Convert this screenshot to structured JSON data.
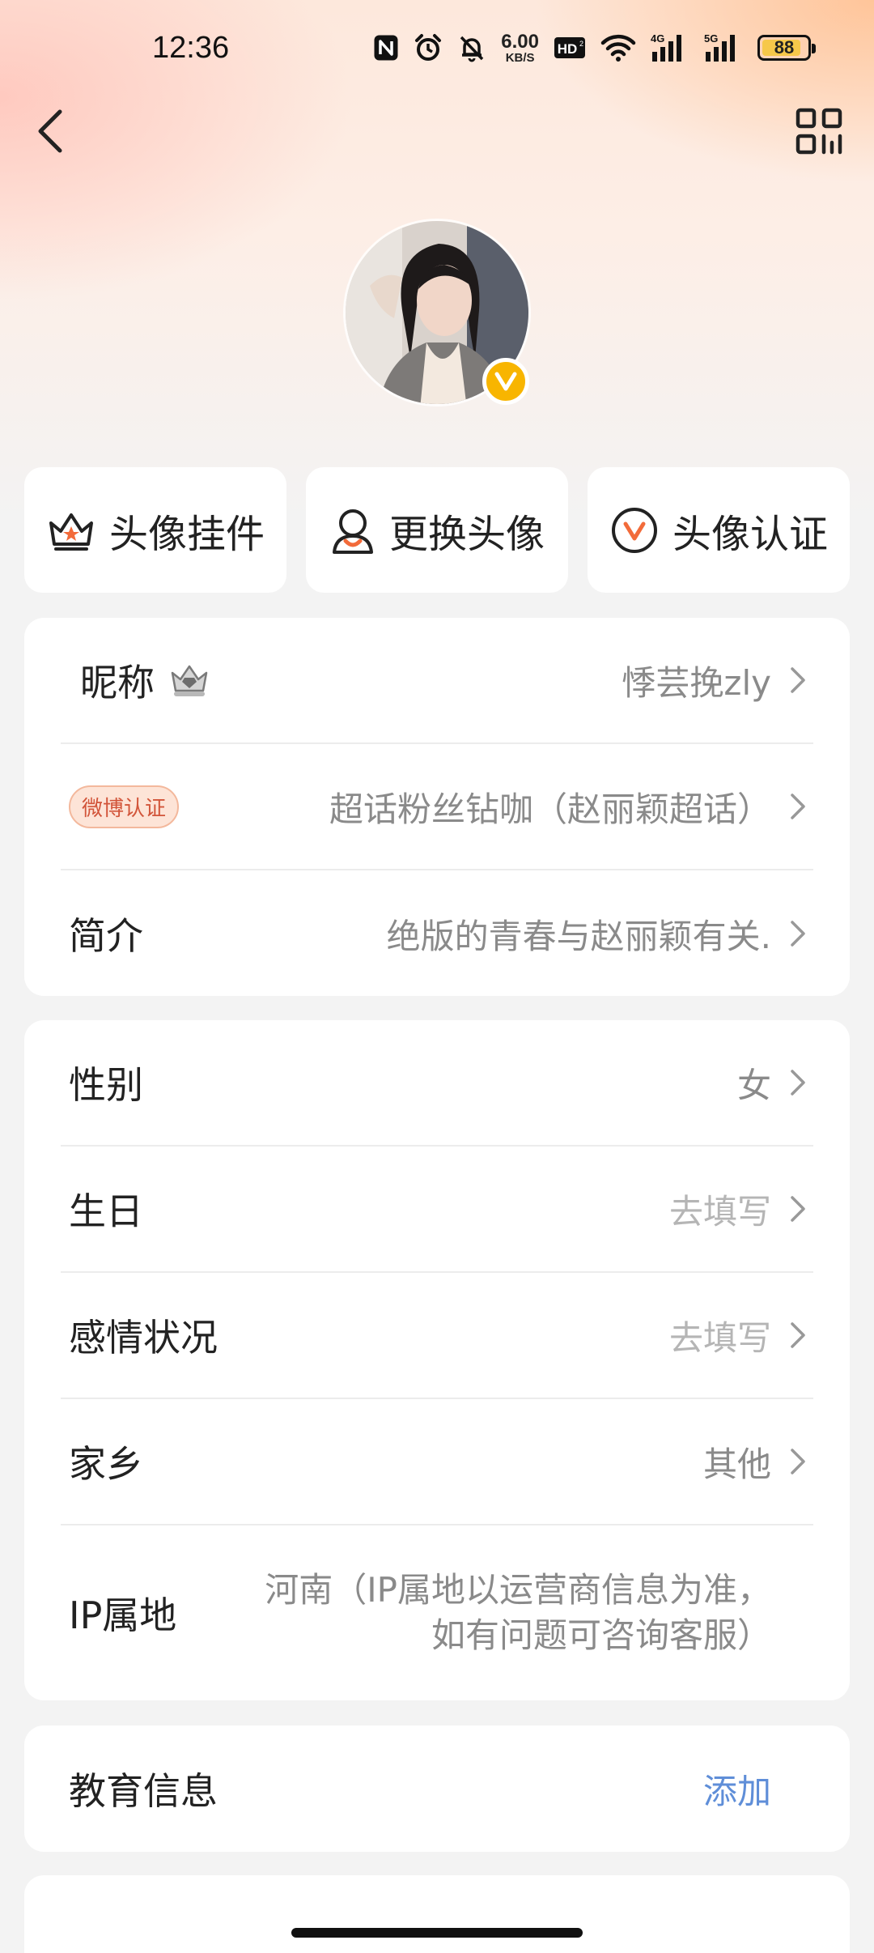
{
  "status_bar": {
    "time": "12:36",
    "net_speed_value": "6.00",
    "net_speed_unit": "KB/S",
    "hd_label": "HD",
    "network_4g": "4G",
    "network_5g": "5G",
    "battery": "88",
    "battery_level": 0.88
  },
  "avatar_actions": [
    {
      "label": "头像挂件",
      "icon": "crown-icon"
    },
    {
      "label": "更换头像",
      "icon": "person-icon"
    },
    {
      "label": "头像认证",
      "icon": "v-badge-icon"
    }
  ],
  "profile": {
    "nickname_label": "昵称",
    "nickname_value": "悸芸挽zly",
    "weibo_tag": "微博认证",
    "verification_value": "超话粉丝钻咖（赵丽颖超话）",
    "bio_label": "简介",
    "bio_value": "绝版的青春与赵丽颖有关."
  },
  "details": {
    "gender_label": "性别",
    "gender_value": "女",
    "birthday_label": "生日",
    "birthday_value": "去填写",
    "relationship_label": "感情状况",
    "relationship_value": "去填写",
    "hometown_label": "家乡",
    "hometown_value": "其他",
    "ip_label": "IP属地",
    "ip_value_line1": "河南（IP属地以运营商信息为准，",
    "ip_value_line2": "如有问题可咨询客服）"
  },
  "education": {
    "label": "教育信息",
    "action": "添加"
  },
  "colors": {
    "accent_orange": "#f26b3a",
    "badge_gold": "#f8b500",
    "link_blue": "#5f8ed8"
  }
}
